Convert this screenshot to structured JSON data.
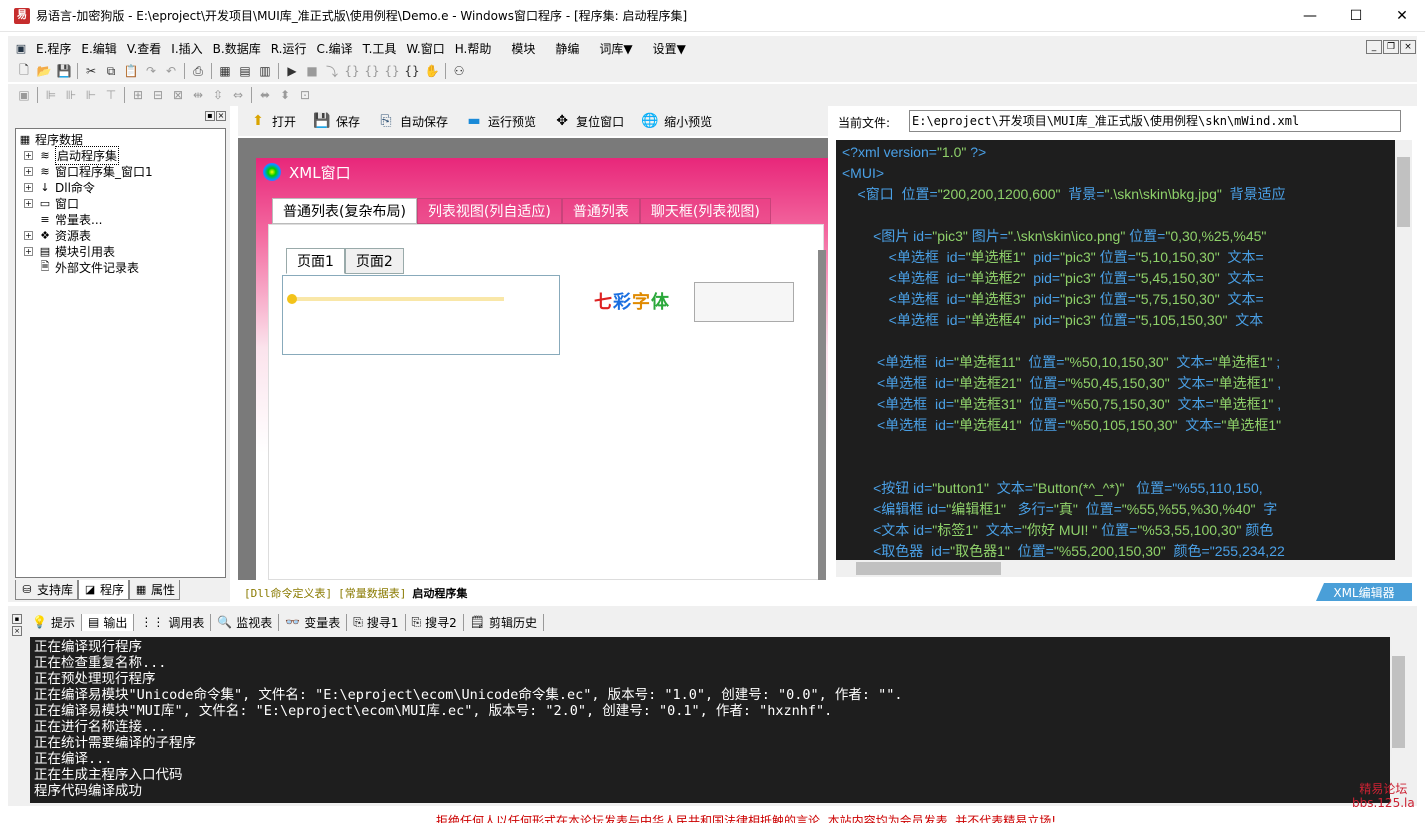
{
  "titlebar": {
    "title": "易语言-加密狗版 - E:\\eproject\\开发项目\\MUI库_准正式版\\使用例程\\Demo.e - Windows窗口程序 - [程序集: 启动程序集]",
    "minimize": "—",
    "maximize": "☐",
    "close": "✕"
  },
  "menu": [
    "E.程序",
    "E.编辑",
    "V.查看",
    "I.插入",
    "B.数据库",
    "R.运行",
    "C.编译",
    "T.工具",
    "W.窗口",
    "H.帮助",
    "模块",
    "静编",
    "词库▼",
    "设置▼"
  ],
  "left_panel": {
    "tree_root": "程序数据",
    "tree_items": [
      "启动程序集",
      "窗口程序集_窗口1",
      "Dll命令",
      "窗口",
      "常量表...",
      "资源表",
      "模块引用表",
      "外部文件记录表"
    ],
    "tabs": [
      "支持库",
      "程序",
      "属性"
    ]
  },
  "preview_toolbar": {
    "buttons": [
      "打开",
      "保存",
      "自动保存",
      "运行预览",
      "复位窗口",
      "缩小预览"
    ]
  },
  "preview": {
    "window_title": "XML窗口",
    "tabs": [
      "普通列表(复杂布局)",
      "列表视图(列自适应)",
      "普通列表",
      "聊天框(列表视图)"
    ],
    "subtabs": [
      "页面1",
      "页面2"
    ],
    "colorful_text": "七彩字体",
    "slider_value": 0
  },
  "doc_tabs": [
    "[Dll命令定义表]",
    "[常量数据表]",
    "启动程序集"
  ],
  "xml_editor": {
    "current_file_label": "当前文件:",
    "current_file": "E:\\eproject\\开发项目\\MUI库_准正式版\\使用例程\\skn\\mWind.xml",
    "tab_label": "XML编辑器",
    "lines": [
      "<?xml version=\"1.0\" ?>",
      "<MUI>",
      "    <窗口  位置=\"200,200,1200,600\"  背景=\".\\skn\\skin\\bkg.jpg\"  背景适应",
      "",
      "        <图片 id=\"pic3\" 图片=\".\\skn\\skin\\ico.png\" 位置=\"0,30,%25,%45\"",
      "            <单选框  id=\"单选框1\"  pid=\"pic3\" 位置=\"5,10,150,30\"  文本=",
      "            <单选框  id=\"单选框2\"  pid=\"pic3\" 位置=\"5,45,150,30\"  文本=",
      "            <单选框  id=\"单选框3\"  pid=\"pic3\" 位置=\"5,75,150,30\"  文本=",
      "            <单选框  id=\"单选框4\"  pid=\"pic3\" 位置=\"5,105,150,30\"  文本",
      "",
      "         <单选框  id=\"单选框11\"  位置=\"%50,10,150,30\"  文本=\"单选框1\" ;",
      "         <单选框  id=\"单选框21\"  位置=\"%50,45,150,30\"  文本=\"单选框1\" ,",
      "         <单选框  id=\"单选框31\"  位置=\"%50,75,150,30\"  文本=\"单选框1\" ,",
      "         <单选框  id=\"单选框41\"  位置=\"%50,105,150,30\"  文本=\"单选框1\"",
      "",
      "",
      "        <按钮 id=\"button1\"  文本=\"Button(*^_^*)\"   位置=\"%55,110,150,",
      "        <编辑框 id=\"编辑框1\"   多行=\"真\"  位置=\"%55,%55,%30,%40\"  字",
      "        <文本 id=\"标签1\"  文本=\"你好 MUI! \" 位置=\"%53,55,100,30\" 颜色",
      "        <取色器  id=\"取色器1\"  位置=\"%55,200,150,30\"  颜色=\"255,234,22"
    ]
  },
  "bottom_tabs": [
    "提示",
    "输出",
    "调用表",
    "监视表",
    "变量表",
    "搜寻1",
    "搜寻2",
    "剪辑历史"
  ],
  "output_lines": [
    "正在编译现行程序",
    "正在检查重复名称...",
    "正在预处理现行程序",
    "正在编译易模块\"Unicode命令集\", 文件名: \"E:\\eproject\\ecom\\Unicode命令集.ec\", 版本号: \"1.0\", 创建号: \"0.0\", 作者: \"\".",
    "正在编译易模块\"MUI库\", 文件名: \"E:\\eproject\\ecom\\MUI库.ec\", 版本号: \"2.0\", 创建号: \"0.1\", 作者: \"hxznhf\".",
    "正在进行名称连接...",
    "正在统计需要编译的子程序",
    "正在编译...",
    "正在生成主程序入口代码",
    "程序代码编译成功"
  ],
  "watermark": {
    "line1": "精易论坛",
    "line2": "bbs.125.la"
  },
  "footer": "拒绝任何人以任何形式在本论坛发表与中华人民共和国法律相抵触的言论, 本站内容均为会员发表, 并不代表精易立场!"
}
